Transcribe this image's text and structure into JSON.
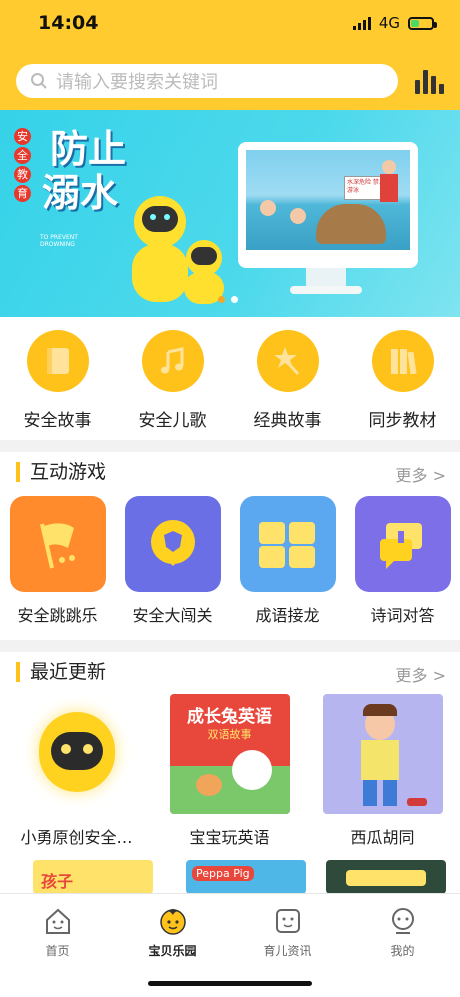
{
  "status": {
    "time": "14:04",
    "network": "4G"
  },
  "search": {
    "placeholder": "请输入要搜索关键词"
  },
  "banner": {
    "badge_chars": [
      "安",
      "全",
      "教",
      "育"
    ],
    "title_line1": "防止",
    "title_line2": "溺水",
    "subtitle": "TO PREVENT DROWNING",
    "sign_text": "水深危险 禁止游泳"
  },
  "categories": [
    {
      "label": "安全故事",
      "icon": "book-icon"
    },
    {
      "label": "安全儿歌",
      "icon": "music-note-icon"
    },
    {
      "label": "经典故事",
      "icon": "star-wand-icon"
    },
    {
      "label": "同步教材",
      "icon": "books-icon"
    }
  ],
  "games_section": {
    "title": "互动游戏",
    "more": "更多 >"
  },
  "games": [
    {
      "label": "安全跳跳乐",
      "tile_color": "#FF8B2D"
    },
    {
      "label": "安全大闯关",
      "tile_color": "#6A6FE6"
    },
    {
      "label": "成语接龙",
      "tile_color": "#5BA8F0"
    },
    {
      "label": "诗词对答",
      "tile_color": "#7C6FE8"
    }
  ],
  "updates_section": {
    "title": "最近更新",
    "more": "更多 >"
  },
  "updates": [
    {
      "label": "小勇原创安全…"
    },
    {
      "label": "宝宝玩英语",
      "thumb_title": "成长兔英语",
      "thumb_sub": "双语故事"
    },
    {
      "label": "西瓜胡同"
    }
  ],
  "peek": {
    "item1": "孩子",
    "item2": "Peppa Pig"
  },
  "tabs": [
    {
      "label": "首页",
      "icon": "home-icon"
    },
    {
      "label": "宝贝乐园",
      "icon": "baby-face-icon",
      "active": true
    },
    {
      "label": "育儿资讯",
      "icon": "news-icon"
    },
    {
      "label": "我的",
      "icon": "user-icon"
    }
  ]
}
